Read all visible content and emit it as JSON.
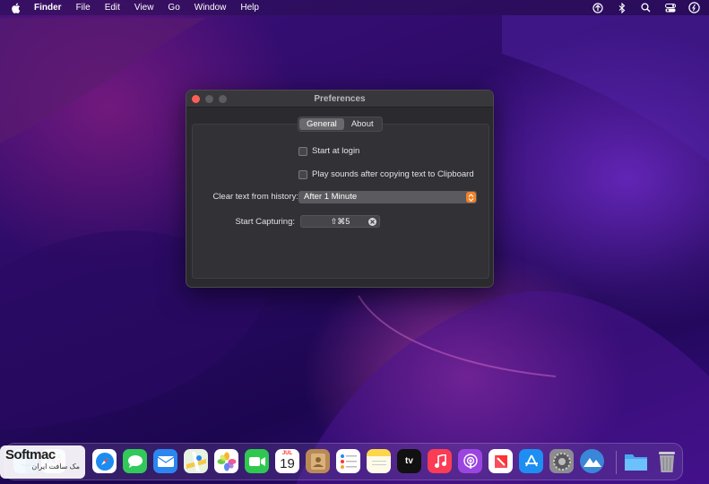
{
  "menubar": {
    "items": [
      "Finder",
      "File",
      "Edit",
      "View",
      "Go",
      "Window",
      "Help"
    ],
    "status_icons": [
      "airdrop-icon",
      "bluetooth-icon",
      "search-icon",
      "control-center-icon",
      "siri-icon"
    ]
  },
  "window": {
    "title": "Preferences",
    "tabs": [
      {
        "label": "General",
        "active": true
      },
      {
        "label": "About",
        "active": false
      }
    ],
    "options": {
      "start_at_login": {
        "label": "Start at login",
        "checked": false
      },
      "play_sounds": {
        "label": "Play sounds after copying text to Clipboard",
        "checked": false
      }
    },
    "clear_history": {
      "label": "Clear text from history:",
      "value": "After 1 Minute"
    },
    "capture": {
      "label": "Start Capturing:",
      "shortcut": "⇧⌘5"
    }
  },
  "dock": {
    "apps": [
      {
        "name": "finder-icon",
        "color": "#2f86e8"
      },
      {
        "name": "launchpad-icon",
        "color": "#d9d9de"
      },
      {
        "name": "safari-icon",
        "color": "#1d8cf0"
      },
      {
        "name": "messages-icon",
        "color": "#32c85a"
      },
      {
        "name": "mail-icon",
        "color": "#2b86f0"
      },
      {
        "name": "maps-icon",
        "color": "#5bbd5a"
      },
      {
        "name": "photos-icon",
        "color": "#ffffff"
      },
      {
        "name": "facetime-icon",
        "color": "#2fc84f"
      },
      {
        "name": "calendar-icon",
        "color": "#ffffff"
      },
      {
        "name": "contacts-icon",
        "color": "#b98a55"
      },
      {
        "name": "reminders-icon",
        "color": "#ffffff"
      },
      {
        "name": "notes-icon",
        "color": "#fcd74b"
      },
      {
        "name": "tv-icon",
        "color": "#111111"
      },
      {
        "name": "music-icon",
        "color": "#fb3c55"
      },
      {
        "name": "podcasts-icon",
        "color": "#9b45e0"
      },
      {
        "name": "news-icon",
        "color": "#ffffff"
      },
      {
        "name": "app-store-icon",
        "color": "#1d8ef2"
      },
      {
        "name": "system-preferences-icon",
        "color": "#8c8c90"
      },
      {
        "name": "cleaner-app-icon",
        "color": "#3a86d8"
      },
      {
        "name": "downloads-folder-icon",
        "color": "#49a8f2"
      },
      {
        "name": "trash-icon",
        "color": "#9a9aa0"
      }
    ],
    "calendar": {
      "month": "JUL",
      "day": "19"
    },
    "tv_label": "tv"
  },
  "watermark": {
    "brand": "Softmac",
    "subtitle": "مک سافت ایران"
  }
}
